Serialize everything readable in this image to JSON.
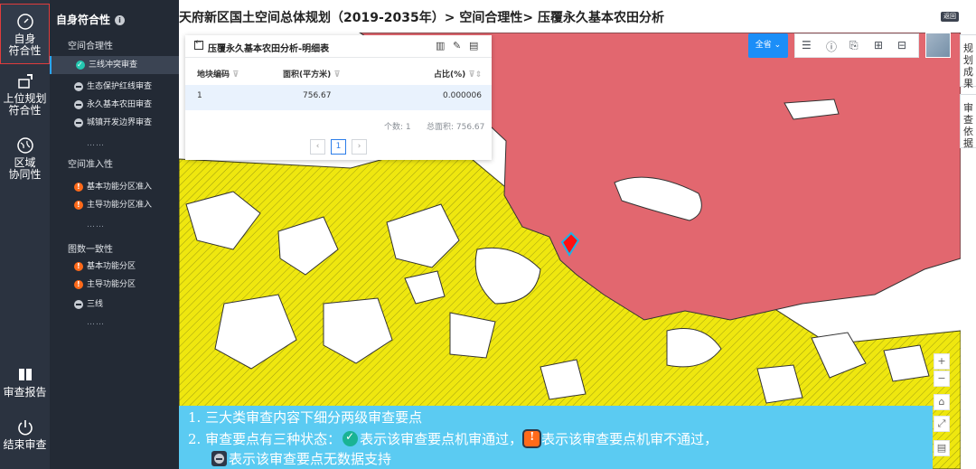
{
  "rail": {
    "items": [
      {
        "label_1": "自身",
        "label_2": "符合性",
        "icon": "compass-icon"
      },
      {
        "label_1": "上位规划",
        "label_2": "符合性",
        "icon": "cursor-icon"
      },
      {
        "label_1": "区域",
        "label_2": "协同性",
        "icon": "region-icon"
      },
      {
        "label_1": "审查报告",
        "icon": "book-icon"
      },
      {
        "label_1": "结束审查",
        "icon": "power-icon"
      }
    ]
  },
  "sidebar": {
    "title": "自身符合性",
    "groups": [
      {
        "title": "空间合理性",
        "items": [
          "三线冲突审查",
          "生态保护红线审查",
          "永久基本农田审查",
          "城镇开发边界审查"
        ],
        "more": "……"
      },
      {
        "title": "空间准入性",
        "items": [
          "基本功能分区准入",
          "主导功能分区准入"
        ],
        "more": "……"
      },
      {
        "title": "图数一致性",
        "items": [
          "基本功能分区",
          "主导功能分区",
          "三线"
        ],
        "more": "……"
      }
    ]
  },
  "header": {
    "title": "天府新区国土空间总体规划（2019-2035年）> 空间合理性> 压覆永久基本农田分析",
    "back_label": "返回"
  },
  "right_tabs": [
    "规划成果",
    "审查依据"
  ],
  "panel": {
    "title": "压覆永久基本农田分析-明细表",
    "columns": [
      "地块编码",
      "面积(平方米)",
      "占比(%)"
    ],
    "rows": [
      {
        "id": "1",
        "area": "756.67",
        "ratio": "0.000006"
      }
    ],
    "count_label": "个数:  1",
    "total_label": "总面积:  756.67",
    "pager": {
      "prev": "‹",
      "current": "1",
      "next": "›"
    }
  },
  "toolbar": {
    "all_label": "全省 ⌄"
  },
  "zoom": {
    "plus": "+",
    "minus": "−",
    "home": "⌂",
    "extent": "⤢",
    "layers": "▤"
  },
  "caption": {
    "line1": "1.   三大类审查内容下细分两级审查要点",
    "line2_a": "2.   审查要点有三种状态：",
    "line2_b": "表示该审查要点机审通过，",
    "line2_c": "表示该审查要点机审不通过，",
    "line3": "表示该审查要点无数据支持"
  },
  "colors": {
    "farmland": "#efe70f",
    "urban": "#e2676f",
    "white_patch": "#ffffff",
    "caption_bg": "#5bcbf2",
    "primary": "#1b8ef8"
  }
}
